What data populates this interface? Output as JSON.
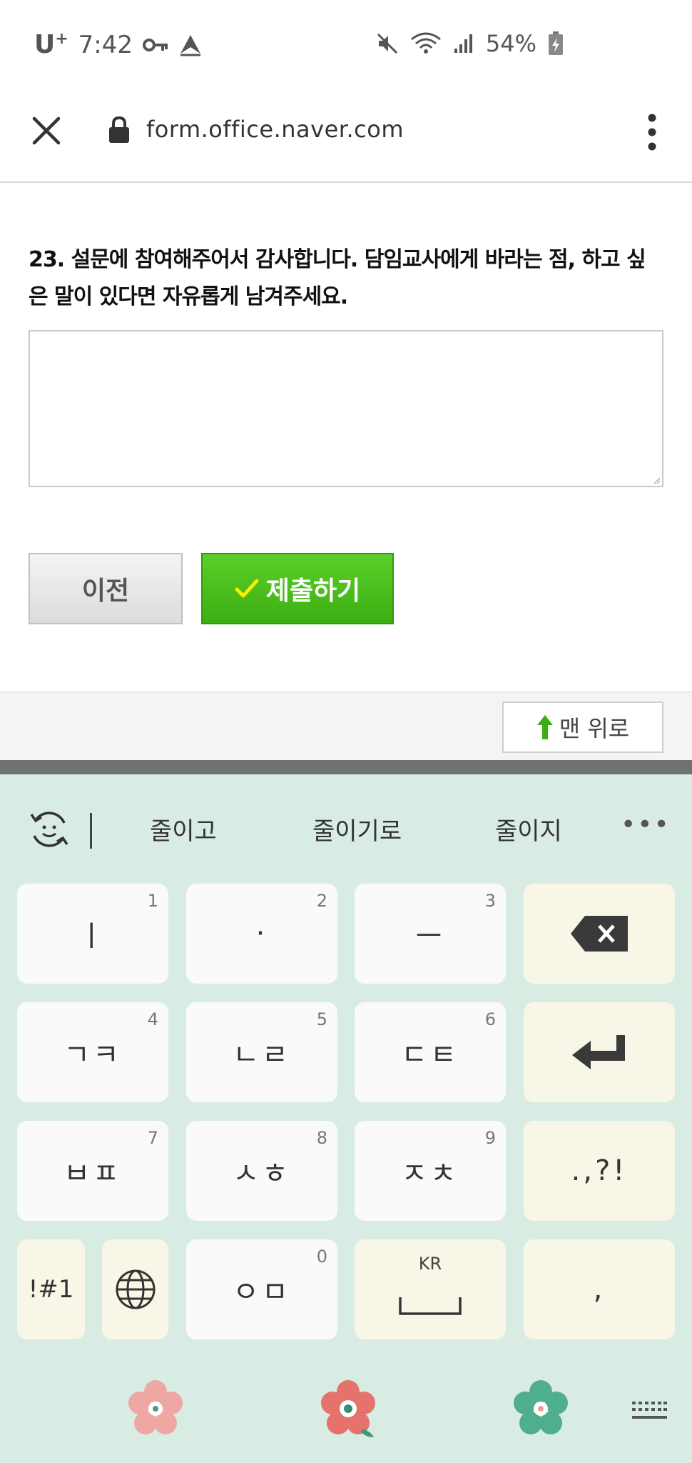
{
  "status": {
    "carrier": "U",
    "carrier_sup": "+",
    "time": "7:42",
    "battery": "54%"
  },
  "browser": {
    "url": "form.office.naver.com"
  },
  "form": {
    "question": "23. 설문에 참여해주어서 감사합니다. 담임교사에게 바라는 점, 하고 싶은 말이 있다면 자유롭게 남겨주세요.",
    "answer_value": "",
    "prev_label": "이전",
    "submit_label": "제출하기",
    "top_label": "맨 위로"
  },
  "keyboard": {
    "suggestions": [
      "줄이고",
      "줄이기로",
      "줄이지"
    ],
    "more": "•••",
    "keys": {
      "k1": {
        "glyph": "ㅣ",
        "num": "1"
      },
      "k2": {
        "glyph": "·",
        "num": "2"
      },
      "k3": {
        "glyph": "ㅡ",
        "num": "3"
      },
      "k4": {
        "glyph": "ㄱㅋ",
        "num": "4"
      },
      "k5": {
        "glyph": "ㄴㄹ",
        "num": "5"
      },
      "k6": {
        "glyph": "ㄷㅌ",
        "num": "6"
      },
      "k7": {
        "glyph": "ㅂㅍ",
        "num": "7"
      },
      "k8": {
        "glyph": "ㅅㅎ",
        "num": "8"
      },
      "k9": {
        "glyph": "ㅈㅊ",
        "num": "9"
      },
      "k0": {
        "glyph": "ㅇㅁ",
        "num": "0"
      },
      "punct": ".,?!",
      "symbols": "!#1",
      "space_label": "KR",
      "comma": ","
    },
    "icons": {
      "backspace": "backspace-icon",
      "enter": "enter-icon",
      "globe": "globe-icon",
      "emoji": "emoji-refresh-icon",
      "hide": "keyboard-hide-icon"
    }
  }
}
